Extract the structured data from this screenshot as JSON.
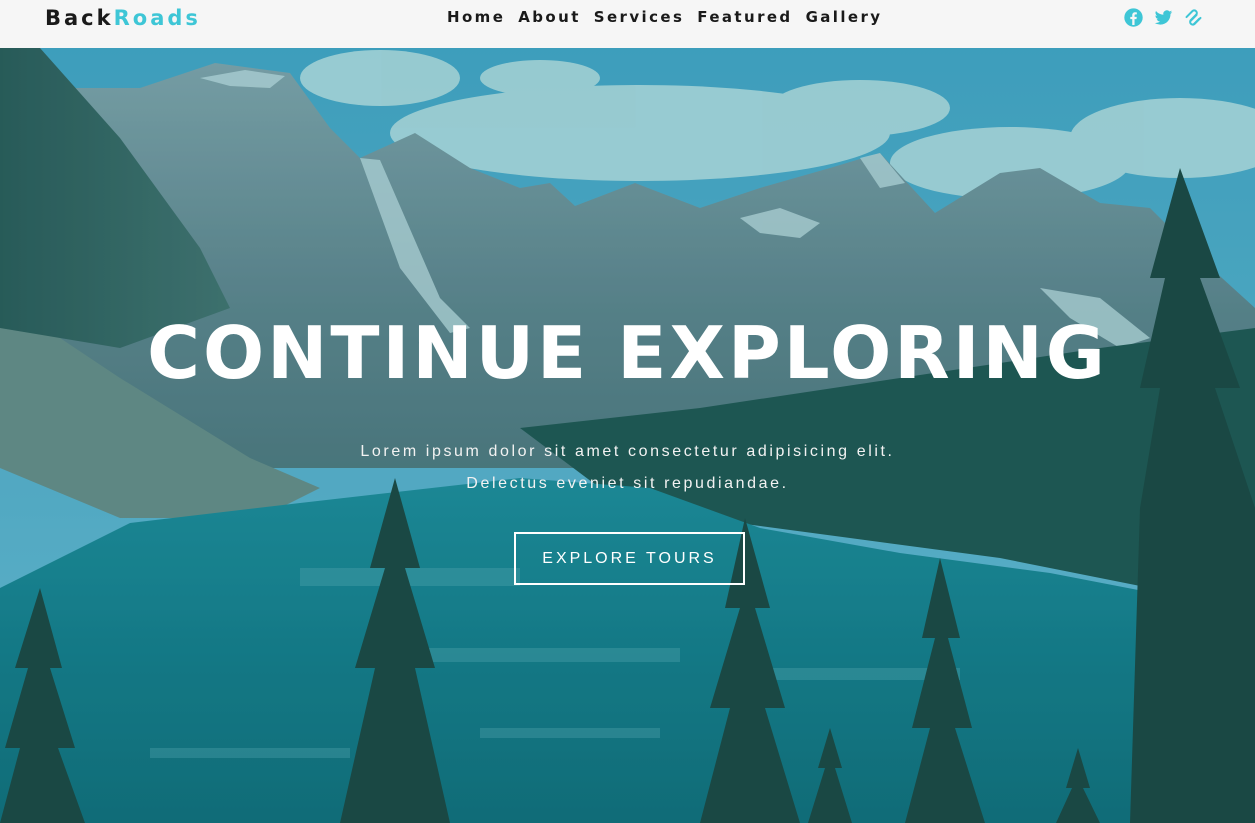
{
  "brand": {
    "part1": "Back",
    "part2": "Roads",
    "accent_color": "#3ec6d6"
  },
  "nav": {
    "links": [
      "Home",
      "About",
      "Services",
      "Featured",
      "Gallery"
    ]
  },
  "social": [
    "facebook-icon",
    "twitter-icon",
    "squarespace-icon"
  ],
  "hero": {
    "title": "CONTINUE EXPLORING",
    "subtitle_line1": "Lorem ipsum dolor sit amet consectetur adipisicing elit.",
    "subtitle_line2": "Delectus eveniet sit repudiandae.",
    "cta": "EXPLORE TOURS"
  }
}
